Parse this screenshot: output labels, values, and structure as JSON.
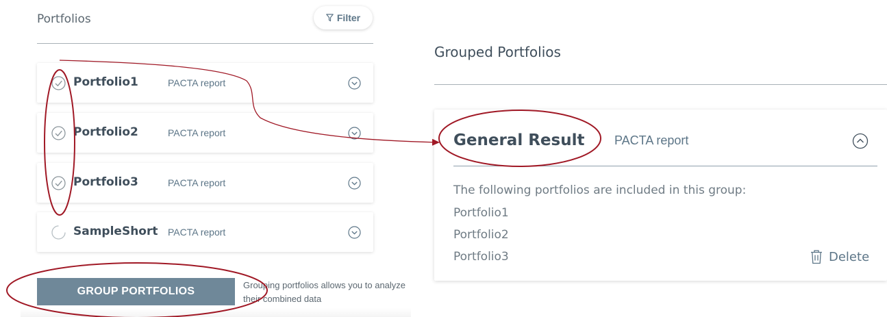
{
  "left_panel": {
    "title": "Portfolios",
    "filter_label": "Filter",
    "portfolios": [
      {
        "name": "Portfolio1",
        "report": "PACTA report",
        "checked": true
      },
      {
        "name": "Portfolio2",
        "report": "PACTA report",
        "checked": true
      },
      {
        "name": "Portfolio3",
        "report": "PACTA report",
        "checked": true
      },
      {
        "name": "SampleShort",
        "report": "PACTA report",
        "checked": false
      }
    ],
    "group_button_label": "GROUP PORTFOLIOS",
    "group_help_text": "Grouping portfolios allows you to analyze their combined data"
  },
  "right_panel": {
    "title": "Grouped Portfolios",
    "group": {
      "name": "General Result",
      "report": "PACTA report",
      "description": "The following portfolios are included in this group:",
      "members": [
        "Portfolio1",
        "Portfolio2",
        "Portfolio3"
      ],
      "delete_label": "Delete"
    }
  },
  "colors": {
    "annotation": "#a01825",
    "button": "#6f8899",
    "accent_text": "#5c7587"
  },
  "icons": {
    "filter": "filter-icon",
    "check": "check-circle-icon",
    "expand": "chevron-down-circle-icon",
    "collapse": "chevron-up-circle-icon",
    "delete": "trash-icon"
  }
}
